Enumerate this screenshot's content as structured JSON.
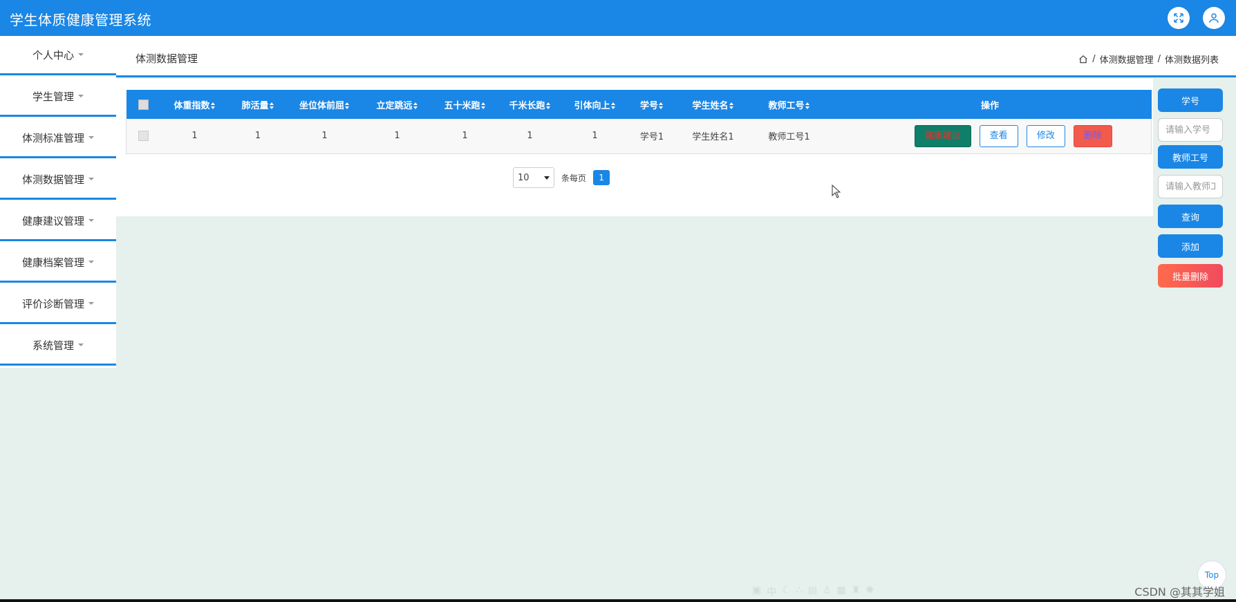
{
  "app": {
    "title": "学生体质健康管理系统",
    "accent_color": "#1a86e5",
    "top_icons": [
      "fullscreen-icon",
      "user-icon"
    ]
  },
  "sidebar": {
    "items": [
      {
        "label": "个人中心"
      },
      {
        "label": "学生管理"
      },
      {
        "label": "体测标准管理"
      },
      {
        "label": "体测数据管理"
      },
      {
        "label": "健康建议管理"
      },
      {
        "label": "健康档案管理"
      },
      {
        "label": "评价诊断管理"
      },
      {
        "label": "系统管理"
      }
    ]
  },
  "header": {
    "page_title": "体测数据管理",
    "breadcrumb": [
      "体测数据管理",
      "体测数据列表"
    ],
    "separator": "/"
  },
  "table": {
    "columns": [
      "体重指数",
      "肺活量",
      "坐位体前屈",
      "立定跳远",
      "五十米跑",
      "千米长跑",
      "引体向上",
      "学号",
      "学生姓名",
      "教师工号"
    ],
    "action_header": "操作",
    "rows": [
      {
        "cells": [
          "1",
          "1",
          "1",
          "1",
          "1",
          "1",
          "1",
          "学号1",
          "学生姓名1",
          "教师工号1"
        ]
      }
    ],
    "actions": {
      "advice": "健康建议",
      "view": "查看",
      "edit": "修改",
      "delete": "删除"
    }
  },
  "pagination": {
    "page_size": "10",
    "per_page_label": "条每页",
    "current_page": "1"
  },
  "filter": {
    "student_no_label": "学号",
    "student_no_placeholder": "请输入学号",
    "teacher_no_label": "教师工号",
    "teacher_no_placeholder": "请输入教师工号",
    "search": "查询",
    "add": "添加",
    "batch_delete": "批量删除"
  },
  "footer": {
    "top_button": "Top",
    "watermark": "CSDN @其其学姐",
    "ime_text": "中"
  }
}
